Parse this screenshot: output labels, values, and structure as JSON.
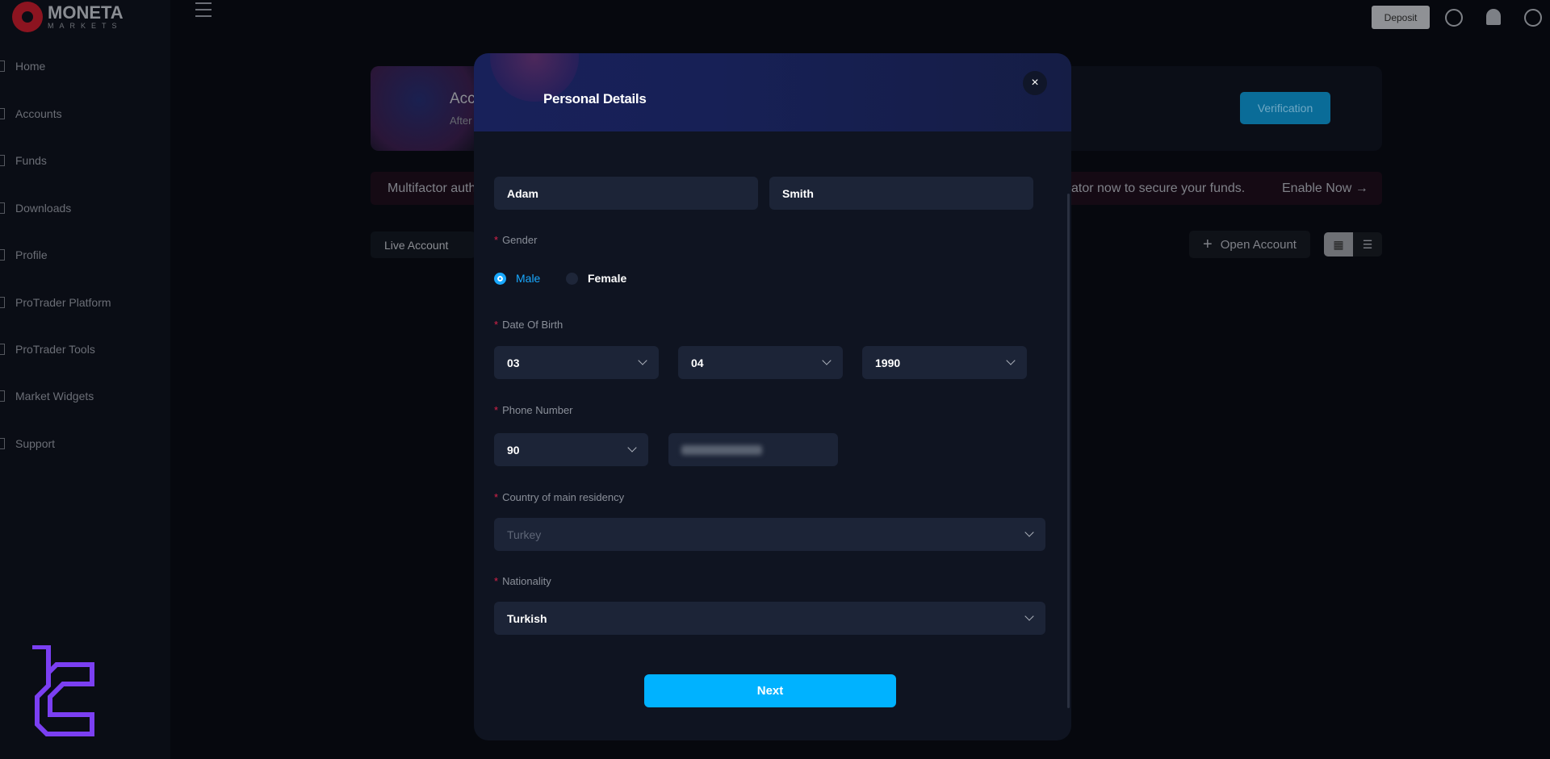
{
  "brand": {
    "name": "MONETA",
    "sub": "MARKETS"
  },
  "sidebar": {
    "items": [
      {
        "label": "Home",
        "icon": "home-icon"
      },
      {
        "label": "Accounts",
        "icon": "accounts-icon"
      },
      {
        "label": "Funds",
        "icon": "funds-icon"
      },
      {
        "label": "Downloads",
        "icon": "download-icon"
      },
      {
        "label": "Profile",
        "icon": "profile-icon"
      },
      {
        "label": "ProTrader Platform",
        "icon": "platform-icon"
      },
      {
        "label": "ProTrader Tools",
        "icon": "tools-icon"
      },
      {
        "label": "Market Widgets",
        "icon": "widgets-icon"
      },
      {
        "label": "Support",
        "icon": "support-icon"
      }
    ]
  },
  "topbar": {
    "deposit": "Deposit"
  },
  "banner": {
    "title": "Acc",
    "subtitle": "After",
    "verification": "Verification"
  },
  "mfa": {
    "text_left": "Multifactor auth",
    "text_right": "ator now to secure your funds.",
    "enable": "Enable Now →"
  },
  "accounts": {
    "tab": "Live Account",
    "open": "Open Account",
    "plus": "+"
  },
  "modal": {
    "title": "Personal Details",
    "close": "×",
    "first_name": "Adam",
    "last_name": "Smith",
    "gender_label": "Gender",
    "gender_options": [
      "Male",
      "Female"
    ],
    "gender_selected": "Male",
    "dob_label": "Date Of Birth",
    "dob_day": "03",
    "dob_month": "04",
    "dob_year": "1990",
    "phone_label": "Phone Number",
    "phone_code": "90",
    "country_label": "Country of main residency",
    "country": "Turkey",
    "nationality_label": "Nationality",
    "nationality": "Turkish",
    "next": "Next",
    "required_mark": "*"
  },
  "colors": {
    "accent": "#00b2ff",
    "required": "#d8234a",
    "watermark": "#7b3ff2"
  }
}
